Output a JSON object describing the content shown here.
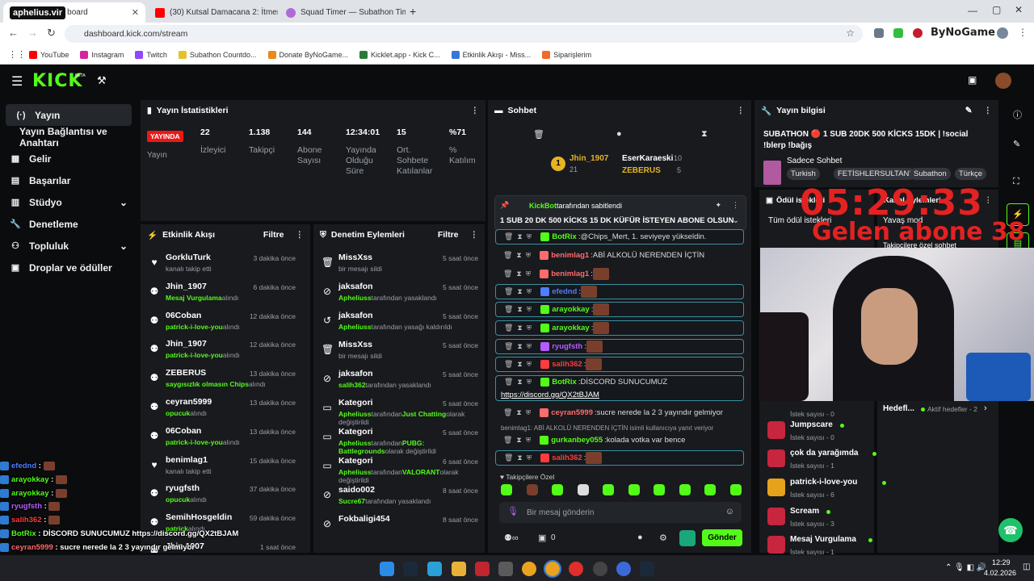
{
  "browser": {
    "tabs": [
      {
        "label": "aphelius.vir",
        "sub": "board"
      },
      {
        "label": "(30) Kutsal Damacana 2: İtmen"
      },
      {
        "label": "Squad Timer — Subathon Time"
      }
    ],
    "url": "dashboard.kick.com/stream",
    "bookmarks": [
      "YouTube",
      "Instagram",
      "Twitch",
      "Subathon Countdo...",
      "Donate ByNoGame...",
      "Kicklet.app - Kick C...",
      "Etkinlik Akışı - Miss...",
      "Siparişlerim"
    ],
    "profile": "ByNoGame"
  },
  "kick": {
    "logo": "KICK",
    "beta": "BETA"
  },
  "sidebar": {
    "items": [
      {
        "label": "Yayın",
        "icon": "(·)"
      },
      {
        "label": "Yayın Bağlantısı ve Anahtarı",
        "icon": ""
      },
      {
        "label": "Gelir",
        "icon": "▦"
      },
      {
        "label": "Başarılar",
        "icon": "▤"
      },
      {
        "label": "Stüdyo",
        "icon": "▥"
      },
      {
        "label": "Denetleme",
        "icon": "🔧"
      },
      {
        "label": "Topluluk",
        "icon": "⚇"
      },
      {
        "label": "Droplar ve ödüller",
        "icon": "▣"
      }
    ]
  },
  "stats": {
    "title": "Yayın İstatistikleri",
    "live_badge": "YAYINDA",
    "live_label": "Yayın",
    "items": [
      {
        "value": "22",
        "label": "İzleyici"
      },
      {
        "value": "1.138",
        "label": "Takipçi"
      },
      {
        "value": "144",
        "label": "Abone Sayısı"
      },
      {
        "value": "12:34:01",
        "label": "Yayında Olduğu Süre"
      },
      {
        "value": "15",
        "label": "Ort. Sohbete Katılanlar"
      },
      {
        "value": "%71",
        "label": "% Katılım"
      }
    ]
  },
  "activity": {
    "title": "Etkinlik Akışı",
    "filter": "Filtre",
    "items": [
      {
        "name": "GorkluTurk",
        "sub": "kanalı takip etti",
        "hl": "",
        "time": "3 dakika önce",
        "icon": "♥"
      },
      {
        "name": "Jhin_1907",
        "sub": "alındı",
        "hl": "Mesaj Vurgulama",
        "time": "6 dakika önce",
        "icon": "⚉"
      },
      {
        "name": "06Coban",
        "sub": "alındı",
        "hl": "patrick-i-love-you",
        "time": "12 dakika önce",
        "icon": "⚉"
      },
      {
        "name": "Jhin_1907",
        "sub": "alındı",
        "hl": "patrick-i-love-you",
        "time": "12 dakika önce",
        "icon": "⚉"
      },
      {
        "name": "ZEBERUS",
        "sub": "alındı",
        "hl": "saygısızlık olmasın Chips",
        "time": "13 dakika önce",
        "icon": "⚉"
      },
      {
        "name": "ceyran5999",
        "sub": "alındı",
        "hl": "opucuk",
        "time": "13 dakika önce",
        "icon": "⚉"
      },
      {
        "name": "06Coban",
        "sub": "alındı",
        "hl": "patrick-i-love-you",
        "time": "13 dakika önce",
        "icon": "⚉"
      },
      {
        "name": "benimlag1",
        "sub": "kanalı takip etti",
        "hl": "",
        "time": "15 dakika önce",
        "icon": "♥"
      },
      {
        "name": "ryugfsth",
        "sub": "alındı",
        "hl": "opucuk",
        "time": "37 dakika önce",
        "icon": "⚉"
      },
      {
        "name": "SemihHosgeldin",
        "sub": "alındı",
        "hl": "patrick",
        "time": "59 dakika önce",
        "icon": "⚉"
      },
      {
        "name": "Jhin 1907",
        "sub": "",
        "hl": "",
        "time": "1 saat önce",
        "icon": "⚉"
      }
    ]
  },
  "moderation": {
    "title": "Denetim Eylemleri",
    "filter": "Filtre",
    "items": [
      {
        "name": "MissXss",
        "sub": "bir mesajı sildi",
        "time": "5 saat önce",
        "icon": "🗑"
      },
      {
        "name": "jaksafon",
        "sub": "tarafından yasaklandı",
        "hl": "Apheliuss",
        "time": "5 saat önce",
        "icon": "⊘"
      },
      {
        "name": "jaksafon",
        "sub": "tarafından yasağı kaldırıldı",
        "hl": "Apheliuss",
        "time": "5 saat önce",
        "icon": "↺"
      },
      {
        "name": "MissXss",
        "sub": "bir mesajı sildi",
        "time": "5 saat önce",
        "icon": "🗑"
      },
      {
        "name": "jaksafon",
        "sub": "tarafından yasaklandı",
        "hl": "salih362",
        "time": "5 saat önce",
        "icon": "⊘"
      },
      {
        "name": "Kategori",
        "sub": "olarak değiştirildi",
        "hl": "Apheliuss",
        "mid": "tarafından",
        "hl2": "Just Chatting",
        "time": "5 saat önce",
        "icon": "▭"
      },
      {
        "name": "Kategori",
        "sub": "olarak değiştirildi",
        "hl": "Apheliuss",
        "mid": "tarafından",
        "hl2": "PUBG: Battlegrounds",
        "time": "5 saat önce",
        "icon": "▭"
      },
      {
        "name": "Kategori",
        "sub": "olarak değiştirildi",
        "hl": "Apheliuss",
        "mid": "tarafından",
        "hl2": "VALORANT",
        "time": "6 saat önce",
        "icon": "▭"
      },
      {
        "name": "saido002",
        "sub": "tarafından yasaklandı",
        "hl": "Sucre67",
        "time": "8 saat önce",
        "icon": "⊘"
      },
      {
        "name": "Fokbaligi454",
        "sub": "",
        "time": "8 saat önce",
        "icon": "⊘"
      }
    ]
  },
  "chat": {
    "title": "Sohbet",
    "leaders": [
      {
        "name": "Jhin_1907",
        "count": "21"
      },
      {
        "name": "EserKaraeski",
        "count": "10"
      },
      {
        "name": "ZEBERUS",
        "count": "5"
      }
    ],
    "pinned": {
      "by": "KickBot",
      "by_suffix": "tarafından sabitlendi",
      "text": "1 SUB 20 DK 500 KİCKS 15 DK KÜFÜR İSTEYEN ABONE OLSUN"
    },
    "messages": [
      {
        "user": "BotRix",
        "color": "#53fc18",
        "text": "@Chips_Mert, 1. seviyeye yükseldin.",
        "hl": true
      },
      {
        "user": "benimlag1",
        "color": "#ff6b6b",
        "text": "ABİ ALKOLÜ NERENDEN İÇTİN",
        "hl": false
      },
      {
        "user": "benimlag1",
        "color": "#ff6b6b",
        "text": "",
        "emote": true,
        "hl": false
      },
      {
        "user": "efednd",
        "color": "#4f7dff",
        "text": "",
        "emote": true,
        "hl": true
      },
      {
        "user": "arayokkay",
        "color": "#53fc18",
        "text": "",
        "emote": true,
        "hl": true
      },
      {
        "user": "arayokkay",
        "color": "#53fc18",
        "text": "",
        "emote": true,
        "hl": true
      },
      {
        "user": "ryugfsth",
        "color": "#b45cff",
        "text": "",
        "emote": true,
        "hl": true
      },
      {
        "user": "salih362",
        "color": "#ff3b3b",
        "text": "",
        "emote": true,
        "hl": true
      },
      {
        "user": "BotRix",
        "color": "#53fc18",
        "text": "DİSCORD SUNUCUMUZ",
        "link": "https://discord.gg/QX2tBJAM",
        "hl": true
      },
      {
        "user": "ceyran5999",
        "color": "#ff6b6b",
        "text": "sucre nerede la 2 3 yayındır gelmiyor",
        "hl": false
      },
      {
        "user": "gurkanbey055",
        "color": "#53fc18",
        "text": "kolada votka var bence",
        "hl": false
      },
      {
        "user": "salih362",
        "color": "#ff3b3b",
        "text": "",
        "emote": true,
        "hl": true
      }
    ],
    "reply_note": "benimlag1: ABİ ALKOLÜ NERENDEN İÇTİN isimli kullanıcıya yanıt veriyor",
    "followers_only": "Takipçilere Özel",
    "input_placeholder": "Bir mesaj gönderin",
    "send": "Gönder",
    "count": "0"
  },
  "info": {
    "title": "Yayın bilgisi",
    "stream_title": "SUBATHON 🔴 1 SUB 20DK 500 KİCKS 15DK | !social !blerp !bağış",
    "channel": "Sadece Sohbet",
    "tags": [
      "Turkish",
      "FETİSHLERSULTANI",
      "Subathon",
      "Türkçe"
    ]
  },
  "rewards": {
    "title": "Ödül istekleri",
    "list_label": "Tüm ödül istekleri",
    "mod_title": "Kanal Eylemleri",
    "slow": "Yavaş mod",
    "followers": "Takipçilere özel sohbet",
    "goals": "Hedefl...",
    "goals_active": "Aktif hedefler - 2",
    "items": [
      {
        "name": "",
        "sub": "İstek sayısı - 0"
      },
      {
        "name": "Jumpscare",
        "sub": "İstek sayısı - 0"
      },
      {
        "name": "çok da yarağımda",
        "sub": "İstek sayısı - 1"
      },
      {
        "name": "patrick-i-love-you",
        "sub": "İstek sayısı - 6"
      },
      {
        "name": "Scream",
        "sub": "İstek sayısı - 3"
      },
      {
        "name": "Mesaj Vurgulama",
        "sub": "İstek sayısı - 1"
      }
    ]
  },
  "overlay": {
    "timer": "05:29:33",
    "subs": "Gelen abone 38"
  },
  "overlay_chat": [
    {
      "user": "efednd",
      "color": "#4f7dff",
      "text": ""
    },
    {
      "user": "arayokkay",
      "color": "#53fc18",
      "text": ""
    },
    {
      "user": "arayokkay",
      "color": "#53fc18",
      "text": ""
    },
    {
      "user": "ryugfsth",
      "color": "#b45cff",
      "text": ""
    },
    {
      "user": "salih362",
      "color": "#ff3b3b",
      "text": ""
    },
    {
      "user": "BotRix",
      "color": "#53fc18",
      "text": "DİSCORD SUNUCUMUZ https://discord.gg/QX2tBJAM"
    },
    {
      "user": "ceyran5999",
      "color": "#ff6b6b",
      "text": "sucre nerede la 2 3 yayındır gelmiyor"
    },
    {
      "user": "gurkanbey055",
      "color": "#ffffff",
      "text": "kolada votka var bence"
    },
    {
      "user": "salih362",
      "color": "#ff3b3b",
      "text": ""
    }
  ],
  "taskbar": {
    "time": "12:29",
    "date": "4.02.2026"
  }
}
